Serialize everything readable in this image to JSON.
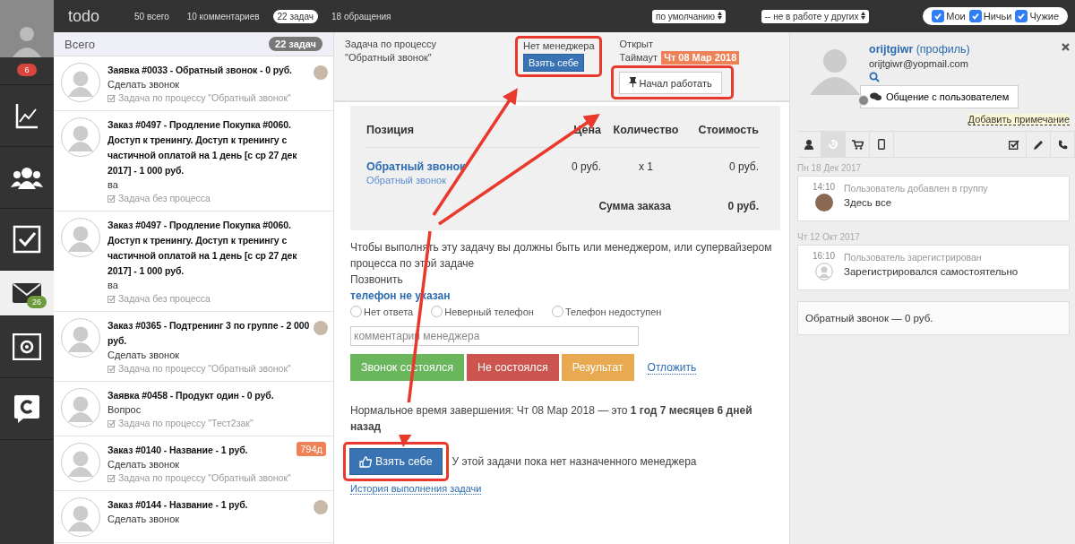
{
  "sidebar": {
    "user_badge": "6",
    "items": [
      {
        "selected": false
      },
      {
        "selected": false
      },
      {
        "selected": false
      },
      {
        "selected": true,
        "badge": "26"
      },
      {
        "selected": false
      },
      {
        "selected": false
      }
    ]
  },
  "topbar": {
    "title": "todo",
    "tabs": [
      {
        "label": "50 всего",
        "selected": false
      },
      {
        "label": "10 комментариев",
        "selected": false
      },
      {
        "label": "22 задач",
        "selected": true
      },
      {
        "label": "18 обращения",
        "selected": false
      }
    ],
    "selects": [
      "по умолчанию",
      "-- не в работе у других"
    ],
    "filters": [
      {
        "label": "Мои",
        "checked": true
      },
      {
        "label": "Ничьи",
        "checked": true
      },
      {
        "label": "Чужие",
        "checked": true
      }
    ]
  },
  "list": {
    "header": "Всего",
    "count": "22 задач",
    "items": [
      {
        "title": "Заявка #0033 - Обратный звонок - 0 руб.",
        "subtitle": "Сделать звонок",
        "process": "Задача по процессу \"Обратный звонок\"",
        "marker": {
          "kind": "avatar"
        }
      },
      {
        "title": "Заказ #0497 - Продление Покупка #0060. Доступ к тренингу. Доступ к тренингу с частичной оплатой на 1 день [с ср 27 дек 2017] - 1 000 руб.",
        "subtitle": "ва",
        "process": "Задача без процесса"
      },
      {
        "title": "Заказ #0497 - Продление Покупка #0060. Доступ к тренингу. Доступ к тренингу с частичной оплатой на 1 день [с ср 27 дек 2017] - 1 000 руб.",
        "subtitle": "ва",
        "process": "Задача без процесса"
      },
      {
        "title": "Заказ #0365 - Подтренинг 3 по группе - 2 000 руб.",
        "subtitle": "Сделать звонок",
        "process": "Задача по процессу \"Обратный звонок\"",
        "marker": {
          "kind": "avatar"
        }
      },
      {
        "title": "Заявка #0458 - Продукт один - 0 руб.",
        "subtitle": "Вопрос",
        "process": "Задача по процессу \"Тест2зак\""
      },
      {
        "title": "Заказ #0140 - Название - 1 руб.",
        "subtitle": "Сделать звонок",
        "process": "Задача по процессу \"Обратный звонок\"",
        "marker": {
          "kind": "badge",
          "text": "794д"
        }
      },
      {
        "title": "Заказ #0144 - Название - 1 руб.",
        "subtitle": "Сделать звонок",
        "marker": {
          "kind": "avatar"
        }
      }
    ]
  },
  "task": {
    "process_label": "Задача по процессу",
    "process_name": "\"Обратный звонок\"",
    "manager_label": "Нет менеджера",
    "take_button": "Взять себе",
    "status": "Открыт",
    "timeout_label": "Таймаут",
    "timeout_value": "Чт 08 Мар 2018",
    "start_button": "Начал работать",
    "table": {
      "columns": [
        "Позиция",
        "Цена",
        "Количество",
        "Стоимость"
      ],
      "rows": [
        {
          "name": "Обратный звонок",
          "sub": "Обратный звонок",
          "price": "0 руб.",
          "qty": "x 1",
          "cost": "0 руб."
        }
      ],
      "total_label": "Сумма заказа",
      "total_value": "0 руб."
    },
    "notice": "Чтобы выполнять эту задачу вы должны быть или менеджером, или супервайзером процесса по этой задаче",
    "call_label": "Позвонить",
    "phone": "телефон не указан",
    "options": [
      {
        "label": "Нет ответа",
        "selected": false
      },
      {
        "label": "Неверный телефон",
        "selected": false
      },
      {
        "label": "Телефон недоступен",
        "selected": false
      }
    ],
    "comment_placeholder": "комментарий менеджера",
    "actions": [
      {
        "label": "Звонок состоялся",
        "kind": "success"
      },
      {
        "label": "Не состоялся",
        "kind": "danger"
      },
      {
        "label": "Результат",
        "kind": "warning"
      },
      {
        "label": "Отложить",
        "kind": "link"
      }
    ],
    "deadline": "Нормальное время завершения: Чт 08 Мар 2018 — это **1 год 7 месяцев 6 дней назад**",
    "take_button_2": "Взять себе",
    "no_manager": "У этой задачи пока нет назначенного менеджера",
    "history_link": "История выполнения задачи"
  },
  "user": {
    "name": "orijtgiwr",
    "profile_link": "(профиль)",
    "email": "orijtgiwr@yopmail.com",
    "chat_button": "Общение с пользователем",
    "note_link": "Добавить примечание",
    "tabs": [
      {
        "selected": false
      },
      {
        "selected": true
      },
      {
        "selected": false
      },
      {
        "selected": false
      },
      {
        "selected": false
      },
      {
        "selected": false
      },
      {
        "selected": false
      }
    ],
    "timeline": [
      {
        "date": "Пн 18 Дек 2017",
        "time": "14:10",
        "title": "Пользователь добавлен в группу",
        "text": "Здесь все",
        "kind": "photo"
      },
      {
        "date": "Чт 12 Окт 2017",
        "time": "16:10",
        "title": "Пользователь зарегистрирован",
        "text": "Зарегистрировался самостоятельно",
        "kind": "silhouette"
      }
    ],
    "summary": "Обратный звонок — 0 руб."
  }
}
